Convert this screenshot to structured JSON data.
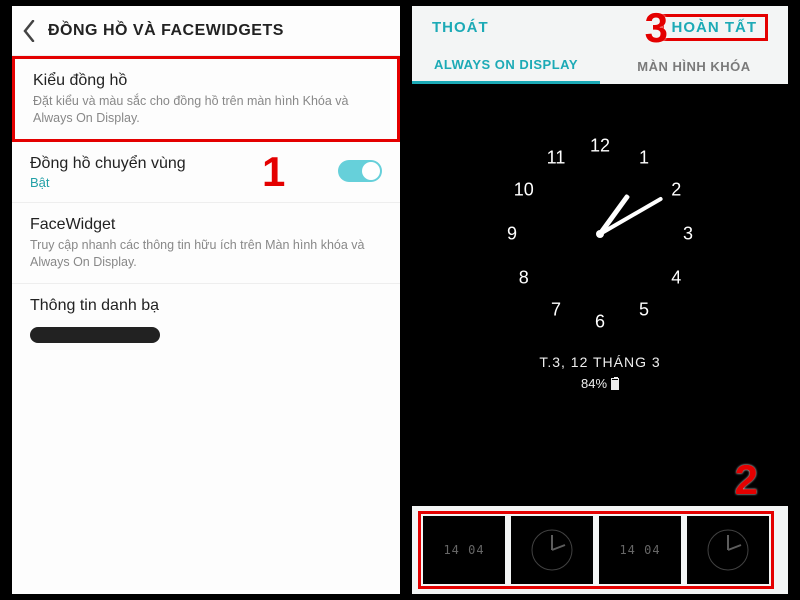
{
  "left": {
    "header_title": "ĐỒNG HỒ VÀ FACEWIDGETS",
    "clock_style_title": "Kiểu đồng hồ",
    "clock_style_desc": "Đặt kiểu và màu sắc cho đồng hồ trên màn hình Khóa và Always On Display.",
    "roaming_title": "Đồng hồ chuyển vùng",
    "roaming_state": "Bật",
    "facewidget_title": "FaceWidget",
    "facewidget_desc": "Truy cập nhanh các thông tin hữu ích trên Màn hình khóa và Always On Display.",
    "contact_title": "Thông tin danh bạ"
  },
  "right": {
    "cancel": "THOÁT",
    "done": "HOÀN TẤT",
    "tab_aod": "ALWAYS ON DISPLAY",
    "tab_lock": "MÀN HÌNH KHÓA",
    "date": "T.3, 12 THÁNG 3",
    "battery": "84%",
    "clock_numbers": [
      "12",
      "1",
      "2",
      "3",
      "4",
      "5",
      "6",
      "7",
      "8",
      "9",
      "10",
      "11"
    ],
    "thumb_digital": "14\n04"
  },
  "markers": {
    "m1": "1",
    "m2": "2",
    "m3": "3"
  },
  "colors": {
    "accent": "#1caab6",
    "highlight": "#e40000"
  }
}
